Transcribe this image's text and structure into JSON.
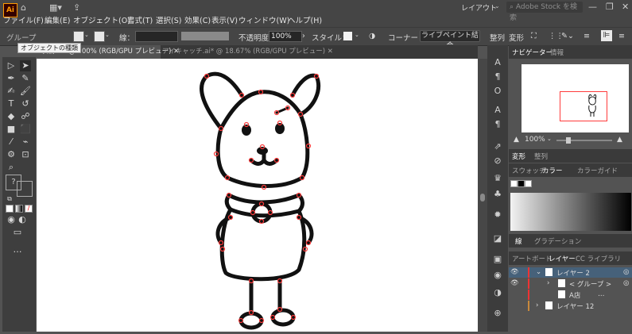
{
  "menus": [
    "ファイル(F)",
    "編集(E)",
    "オブジェクト(O)",
    "書式(T)",
    "選択(S)",
    "効果(C)",
    "表示(V)",
    "ウィンドウ(W)",
    "ヘルプ(H)"
  ],
  "app_logo": "Ai",
  "workspace": "レイアウト",
  "search_placeholder": "Adobe Stock を検索",
  "control": {
    "selection": "グループ",
    "stroke_label": "線：",
    "opacity_label": "不透明度：",
    "opacity_value": "100%",
    "style_label": "スタイル：",
    "corner": "コーナー",
    "live_paint": "ライブペイント結合",
    "align": "整列",
    "transform": "変形"
  },
  "tooltip": "オブジェクトの種類",
  "tabs": [
    "表情.ai* @ 100% (RGB/GPU プレビュー)",
    "アイキャッチ.ai* @ 18.67% (RGB/GPU プレビュー)"
  ],
  "navigator": {
    "tab": "ナビゲーター",
    "tab2": "情報",
    "zoom": "100%"
  },
  "transform_panel": {
    "tab": "変形",
    "tab2": "整列"
  },
  "color_panel": {
    "tabs": [
      "スウォッチ",
      "カラー",
      "カラーガイド"
    ]
  },
  "stroke_panel": {
    "tab": "線",
    "tab2": "グラデーション"
  },
  "layers_panel": {
    "tabs": [
      "アートボード",
      "レイヤー",
      "CC ライブラリ"
    ],
    "rows": [
      "レイヤー 2",
      "< グループ >",
      "A店",
      "…",
      "レイヤー 12"
    ]
  },
  "colors": {
    "accent": "#ff9a00",
    "selection": "#ff3b3b",
    "layer_highlight": "#46617a"
  }
}
